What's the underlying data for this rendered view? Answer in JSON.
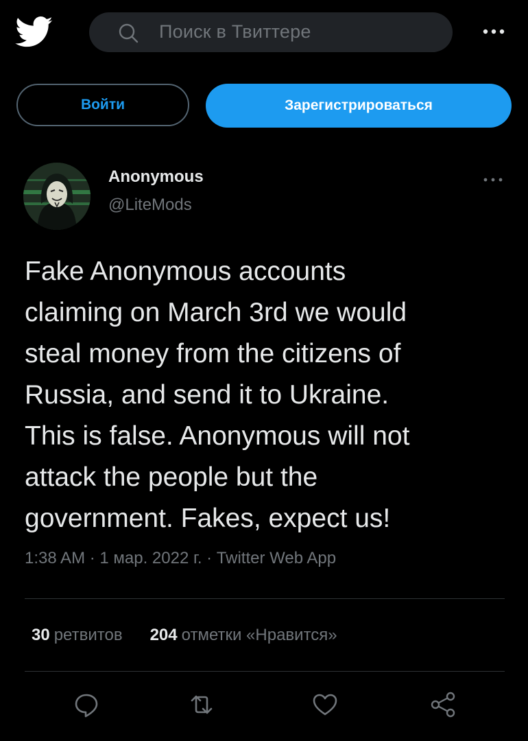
{
  "header": {
    "logo_icon": "twitter-bird-icon",
    "search_placeholder": "Поиск в Твиттере",
    "more_icon": "more-horizontal-icon"
  },
  "auth": {
    "login_label": "Войти",
    "signup_label": "Зарегистрироваться"
  },
  "tweet": {
    "author_name": "Anonymous",
    "author_handle": "@LiteMods",
    "text": "Fake Anonymous accounts\nclaiming on March 3rd we would\nsteal money from the citizens of\nRussia, and send it to Ukraine.\nThis is false. Anonymous will not\nattack the people but the\ngovernment. Fakes, expect us!",
    "meta": "1:38 AM · 1 мар. 2022 г. · Twitter Web App",
    "retweets_count": "30",
    "retweets_label": "ретвитов",
    "likes_count": "204",
    "likes_label": "отметки «Нравится»"
  },
  "colors": {
    "background": "#000000",
    "accent": "#1d9bf0",
    "text_primary": "#e7e9ea",
    "text_secondary": "#71767b",
    "divider": "#2f3336"
  },
  "actions": [
    "reply-icon",
    "retweet-icon",
    "like-icon",
    "share-icon"
  ]
}
